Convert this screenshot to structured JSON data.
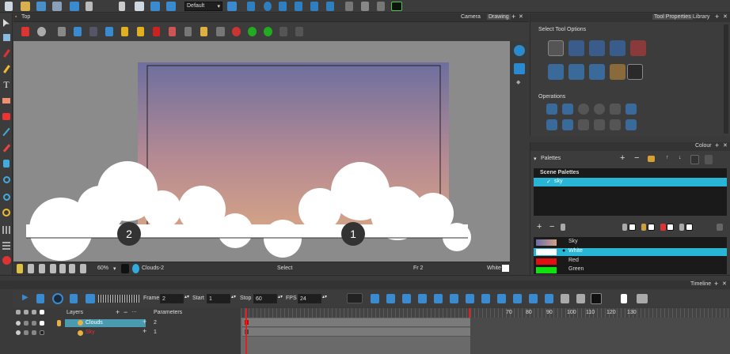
{
  "top_toolbar": {
    "preset": "Default"
  },
  "view": {
    "title": "Top",
    "tabs": [
      "Camera",
      "Drawing"
    ],
    "status": {
      "zoom": "60%",
      "drawing": "Clouds-2",
      "tool": "Select",
      "frame": "Fr 2",
      "color": "White"
    },
    "markers": [
      "2",
      "1"
    ]
  },
  "tool_properties": {
    "tabs": [
      "Tool Properties",
      "Library"
    ],
    "select_tool_options": "Select Tool Options",
    "operations": "Operations"
  },
  "colour": {
    "title": "Colour",
    "palettes_label": "Palettes",
    "scene_palettes": "Scene Palettes",
    "palette_items": [
      {
        "name": "sky"
      }
    ],
    "swatches": [
      {
        "name": "Sky",
        "color": "#6b6dab"
      },
      {
        "name": "White",
        "color": "#ffffff"
      },
      {
        "name": "Red",
        "color": "#e01010"
      },
      {
        "name": "Green",
        "color": "#10e010"
      }
    ]
  },
  "timeline": {
    "title": "Timeline",
    "frame_label": "Frame",
    "frame_value": "2",
    "start_label": "Start",
    "start_value": "1",
    "stop_label": "Stop",
    "stop_value": "60",
    "fps_label": "FPS",
    "fps_value": "24",
    "layers_header": "Layers",
    "parameters_header": "Parameters",
    "layers": [
      {
        "name": "Clouds",
        "number": "2"
      },
      {
        "name": "Sky",
        "number": "1"
      }
    ],
    "ruler": [
      "70",
      "80",
      "90",
      "100",
      "110",
      "120",
      "130"
    ]
  }
}
